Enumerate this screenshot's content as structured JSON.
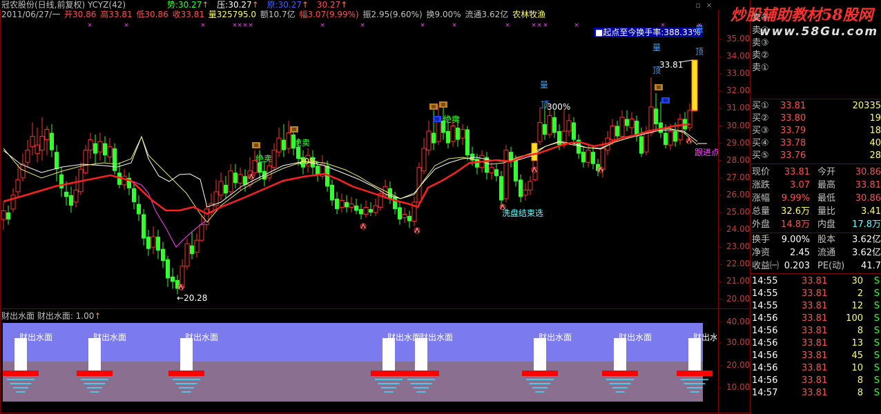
{
  "header": {
    "title": "冠农股份(日线,前复权) YCYZ(42)",
    "date": "2011/06/27/一",
    "open": "开30.86",
    "high": "高33.81",
    "low": "低30.86",
    "close": "收33.81",
    "volume": "量325795.0",
    "amount": "额10.7亿",
    "change": "幅3.07(9.99%)",
    "amplitude": "振2.95(9.60%)",
    "turnover": "换9.00%",
    "float": "流通3.62亿",
    "industry": "农林牧渔"
  },
  "indicator_line": {
    "shi_label": "势:",
    "shi_value": "30.27",
    "ya_label": "压:",
    "ya_value": "30.27",
    "yuan_label": "原:",
    "yuan_value": "30.27",
    "x_value": "30.27"
  },
  "chart_annotations": {
    "turnover_note": "■起点至今换手率:388.33%",
    "price_high_label": "33.81",
    "price_low_label": "20.28",
    "jue_mai_1": "绝卖",
    "jue_mai_2": "绝卖",
    "jue_mai_3": "绝卖",
    "pct_20": "20%",
    "pct_300": "300%",
    "xipan": "洗盘结束选",
    "liang_1": "量",
    "liang_2": "量",
    "liang_3": "量",
    "ding_1": "顶",
    "ding_2": "顶",
    "ding_3": "顶",
    "gen_jin": "跟进点"
  },
  "price_axis": [
    "35.00",
    "34.00",
    "33.00",
    "32.00",
    "31.00",
    "30.00",
    "29.00",
    "28.00",
    "27.00",
    "26.00",
    "25.00",
    "24.00",
    "23.00",
    "22.00",
    "21.00",
    "20.00"
  ],
  "sub_chart": {
    "title": "财出水面 财出水面: 1.00",
    "label": "财出水面",
    "axis": [
      "40.00",
      "30.00",
      "20.00",
      "10.00"
    ],
    "markers": [
      "财出水面",
      "财出水面",
      "财出水面",
      "财出水面",
      "财出水面",
      "财出水面",
      "财出水面",
      "财出水面"
    ]
  },
  "order_book": {
    "sell": [
      {
        "label": "卖⑤"
      },
      {
        "label": "卖④"
      },
      {
        "label": "卖③"
      },
      {
        "label": "卖②"
      },
      {
        "label": "卖①"
      }
    ],
    "buy": [
      {
        "label": "买①",
        "price": "33.81",
        "vol": "20335"
      },
      {
        "label": "买②",
        "price": "33.80",
        "vol": "19"
      },
      {
        "label": "买③",
        "price": "33.79",
        "vol": "18"
      },
      {
        "label": "买④",
        "price": "33.78",
        "vol": "40"
      },
      {
        "label": "买⑤",
        "price": "33.76",
        "vol": "28"
      }
    ]
  },
  "quote": {
    "rows": [
      {
        "l1": "现价",
        "v1": "33.81",
        "l2": "今开",
        "v2": "30.86"
      },
      {
        "l1": "涨跌",
        "v1": "3.07",
        "l2": "最高",
        "v2": "33.81"
      },
      {
        "l1": "涨幅",
        "v1": "9.99%",
        "l2": "最低",
        "v2": "30.86"
      },
      {
        "l1": "总量",
        "v1": "32.6万",
        "l2": "量比",
        "v2": "3.41"
      },
      {
        "l1": "外盘",
        "v1": "14.8万",
        "l2": "内盘",
        "v2": "17.8万"
      }
    ],
    "rows2": [
      {
        "l1": "换手",
        "v1": "9.00%",
        "l2": "股本",
        "v2": "3.62亿"
      },
      {
        "l1": "净资",
        "v1": "2.45",
        "l2": "流通",
        "v2": "3.62亿"
      },
      {
        "l1": "收益㈠",
        "v1": "0.203",
        "l2": "PE(动)",
        "v2": "41.7"
      }
    ]
  },
  "ticks": [
    {
      "time": "14:55",
      "price": "33.81",
      "vol": "30",
      "side": "S"
    },
    {
      "time": "14:55",
      "price": "33.81",
      "vol": "2",
      "side": "S"
    },
    {
      "time": "14:55",
      "price": "33.81",
      "vol": "12",
      "side": "S"
    },
    {
      "time": "14:56",
      "price": "33.81",
      "vol": "100",
      "side": "S"
    },
    {
      "time": "14:56",
      "price": "33.81",
      "vol": "8",
      "side": "S"
    },
    {
      "time": "14:56",
      "price": "33.81",
      "vol": "13",
      "side": "S"
    },
    {
      "time": "14:56",
      "price": "33.81",
      "vol": "45",
      "side": "S"
    },
    {
      "time": "14:56",
      "price": "33.81",
      "vol": "10",
      "side": "S"
    },
    {
      "time": "14:56",
      "price": "33.81",
      "vol": "8",
      "side": "S"
    },
    {
      "time": "14:57",
      "price": "33.81",
      "vol": "8",
      "side": "S"
    }
  ],
  "brand": {
    "text": "炒股辅助教材58股网",
    "url": "www.58Gu.com"
  },
  "colors": {
    "up": "#ff3030",
    "down": "#30ff30",
    "ma_red": "#ff2020",
    "ma_white": "#ffffff",
    "ma_yellow": "#ffff80",
    "ma_magenta": "#ff40ff",
    "frame": "#800000",
    "water_top": "#7b7bef",
    "water_bottom": "#8a6f90"
  }
}
